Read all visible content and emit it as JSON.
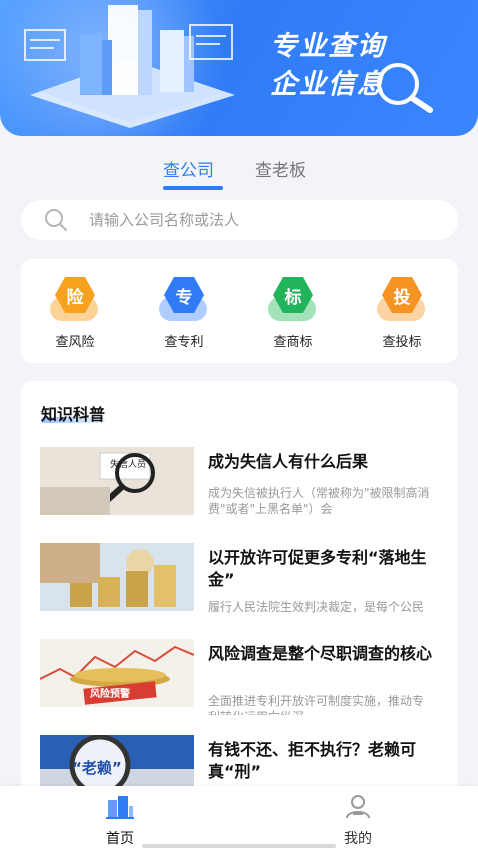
{
  "banner": {
    "slogan_line1": "专业查询",
    "slogan_line2": "企业信息"
  },
  "tabs": [
    {
      "label": "查公司",
      "active": true
    },
    {
      "label": "查老板",
      "active": false
    }
  ],
  "search": {
    "placeholder": "请输入公司名称或法人",
    "value": ""
  },
  "quick_actions": [
    {
      "badge": "险",
      "label": "查风险",
      "color": "#f6a21e",
      "icon": "risk-icon"
    },
    {
      "badge": "专",
      "label": "查专利",
      "color": "#2f7cf6",
      "icon": "patent-icon"
    },
    {
      "badge": "标",
      "label": "查商标",
      "color": "#22b45a",
      "icon": "trademark-icon"
    },
    {
      "badge": "投",
      "label": "查投标",
      "color": "#f59422",
      "icon": "bid-icon"
    }
  ],
  "knowledge": {
    "title": "知识科普",
    "articles": [
      {
        "title": "成为失信人有什么后果",
        "desc": "成为失信被执行人（常被称为\"被限制高消费\"或者\"上黑名单\"）会",
        "thumb_text": "失信人员"
      },
      {
        "title": "以开放许可促更多专利“落地生金”",
        "desc": "履行人民法院生效判决裁定，是每个公民应尽的义务，一旦成为",
        "thumb_text": ""
      },
      {
        "title": "风险调查是整个尽职调查的核心",
        "desc": "全面推进专利开放许可制度实施，推动专利转化运用向纵深",
        "thumb_text": "风险预警"
      },
      {
        "title": "有钱不还、拒不执行？老赖可真“刑”",
        "desc": "",
        "thumb_text": "“老赖”"
      }
    ]
  },
  "tabbar": {
    "items": [
      {
        "label": "首页",
        "active": true,
        "icon": "home-icon"
      },
      {
        "label": "我的",
        "active": false,
        "icon": "profile-icon"
      }
    ]
  },
  "colors": {
    "accent": "#2f7cf6",
    "background": "#f2f4f7"
  }
}
